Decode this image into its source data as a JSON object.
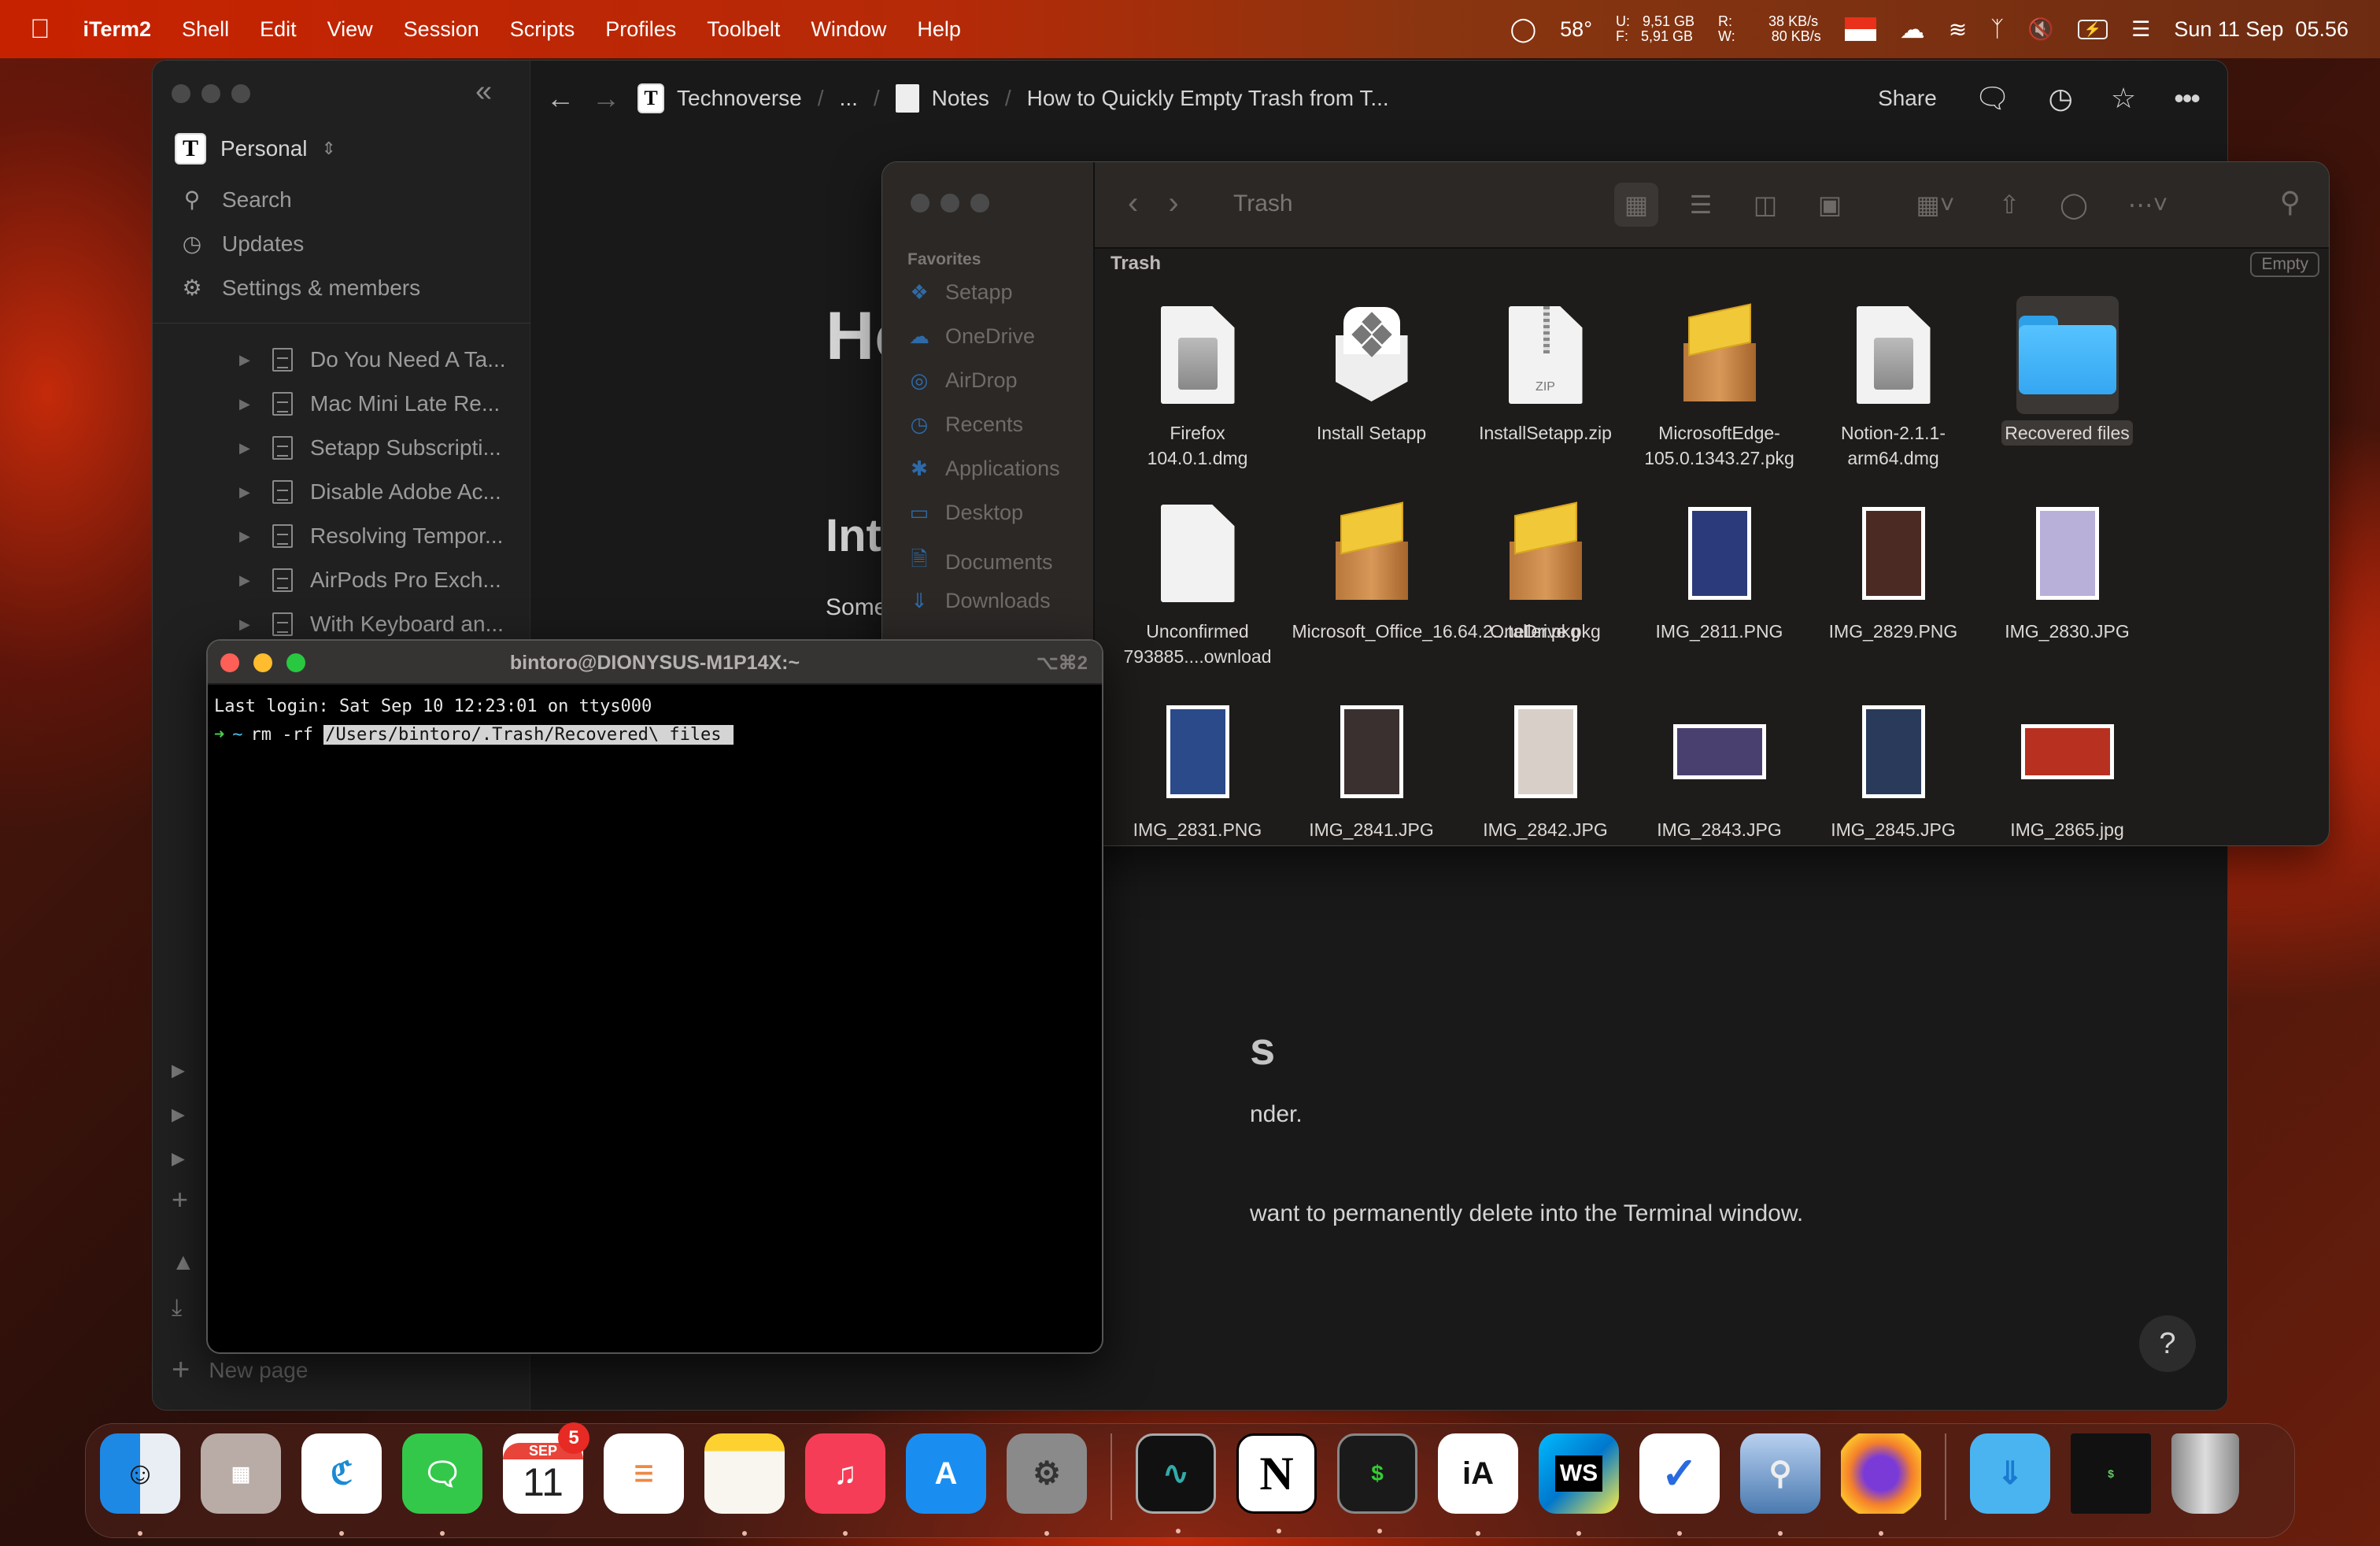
{
  "menubar": {
    "apple": "",
    "app_name": "iTerm2",
    "menus": [
      "Shell",
      "Edit",
      "View",
      "Session",
      "Scripts",
      "Profiles",
      "Toolbelt",
      "Window",
      "Help"
    ],
    "status": {
      "temperature": "58°",
      "disk_u_label": "U:",
      "disk_u": "9,51 GB",
      "disk_f_label": "F:",
      "disk_f": "5,91 GB",
      "net_r_label": "R:",
      "net_r": "38 KB/s",
      "net_w_label": "W:",
      "net_w": "80 KB/s",
      "datetime": "Sun 11 Sep  05.56"
    }
  },
  "notion": {
    "workspace": "Personal",
    "nav": [
      {
        "label": "Search",
        "icon": "search-icon"
      },
      {
        "label": "Updates",
        "icon": "clock-icon"
      },
      {
        "label": "Settings & members",
        "icon": "gear-icon"
      }
    ],
    "pages": [
      "Do You Need A Ta...",
      "Mac Mini Late Re...",
      "Setapp Subscripti...",
      "Disable Adobe Ac...",
      "Resolving Tempor...",
      "AirPods Pro Exch...",
      "With Keyboard an..."
    ],
    "new_page": "New page",
    "breadcrumb": {
      "workspace": "Technoverse",
      "ellipsis": "...",
      "parent": "Notes",
      "current": "How to Quickly Empty Trash from T..."
    },
    "share": "Share",
    "doc": {
      "title": "How to Quickly Empty Trash from Terminal",
      "h2": "Introduction",
      "p1": "Some",
      "frag_heading": "s",
      "frag_1": "nder.",
      "frag_2": "want to permanently delete into the Terminal window."
    },
    "help": "?"
  },
  "finder": {
    "title": "Trash",
    "path_label": "Trash",
    "empty_button": "Empty",
    "favorites_label": "Favorites",
    "favorites": [
      {
        "label": "Setapp",
        "icon": "setapp-icon"
      },
      {
        "label": "OneDrive",
        "icon": "cloud-icon"
      },
      {
        "label": "AirDrop",
        "icon": "airdrop-icon"
      },
      {
        "label": "Recents",
        "icon": "clock-icon"
      },
      {
        "label": "Applications",
        "icon": "applications-icon"
      },
      {
        "label": "Desktop",
        "icon": "desktop-icon"
      },
      {
        "label": "Documents",
        "icon": "document-icon"
      },
      {
        "label": "Downloads",
        "icon": "download-icon"
      }
    ],
    "files": [
      {
        "name": "Firefox 104.0.1.dmg",
        "kind": "dmg"
      },
      {
        "name": "Install Setapp",
        "kind": "setapp"
      },
      {
        "name": "InstallSetapp.zip",
        "kind": "zip"
      },
      {
        "name": "MicrosoftEdge-105.0.1343.27.pkg",
        "kind": "pkg"
      },
      {
        "name": "Notion-2.1.1-arm64.dmg",
        "kind": "dmg"
      },
      {
        "name": "Recovered files",
        "kind": "folder",
        "selected": true
      },
      {
        "name": "Unconfirmed 793885....ownload",
        "kind": "file"
      },
      {
        "name": "Microsoft_Office_16.64.2...taller.pkg",
        "kind": "pkg"
      },
      {
        "name": "OneDrive.pkg",
        "kind": "pkg"
      },
      {
        "name": "IMG_2811.PNG",
        "kind": "image",
        "color": "#2a3a7a"
      },
      {
        "name": "IMG_2829.PNG",
        "kind": "image",
        "color": "#4a2a22"
      },
      {
        "name": "IMG_2830.JPG",
        "kind": "image",
        "color": "#b8b0d8"
      },
      {
        "name": "IMG_2831.PNG",
        "kind": "image",
        "color": "#2a4a8a"
      },
      {
        "name": "IMG_2841.JPG",
        "kind": "image",
        "color": "#3a3030"
      },
      {
        "name": "IMG_2842.JPG",
        "kind": "image",
        "color": "#d8d0c8"
      },
      {
        "name": "IMG_2843.JPG",
        "kind": "image-wide",
        "color": "#4a4070"
      },
      {
        "name": "IMG_2845.JPG",
        "kind": "image",
        "color": "#2a3a5a"
      },
      {
        "name": "IMG_2865.jpg",
        "kind": "image-wide",
        "color": "#b83020"
      }
    ]
  },
  "terminal": {
    "title": "bintoro@DIONYSUS-M1P14X:~",
    "shortcut": "⌥⌘2",
    "last_login": "Last login: Sat Sep 10 12:23:01 on ttys000",
    "prompt_arrow": "➜",
    "prompt_dir": "~",
    "command": "rm -rf",
    "selected_arg": "/Users/bintoro/.Trash/Recovered\\ files "
  },
  "dock": {
    "apps": [
      "Finder",
      "Launchpad",
      "Microsoft Edge",
      "Messages",
      "Calendar",
      "Reminders",
      "Notes",
      "Music",
      "App Store",
      "System Preferences",
      "Activity Monitor",
      "Notion",
      "Terminal",
      "iA Writer",
      "WebStorm",
      "Microsoft To Do",
      "Preview",
      "Firefox",
      "Downloads",
      "iTerm2 window",
      "Trash"
    ],
    "calendar_month": "SEP",
    "calendar_day": "11",
    "calendar_badge": "5"
  }
}
